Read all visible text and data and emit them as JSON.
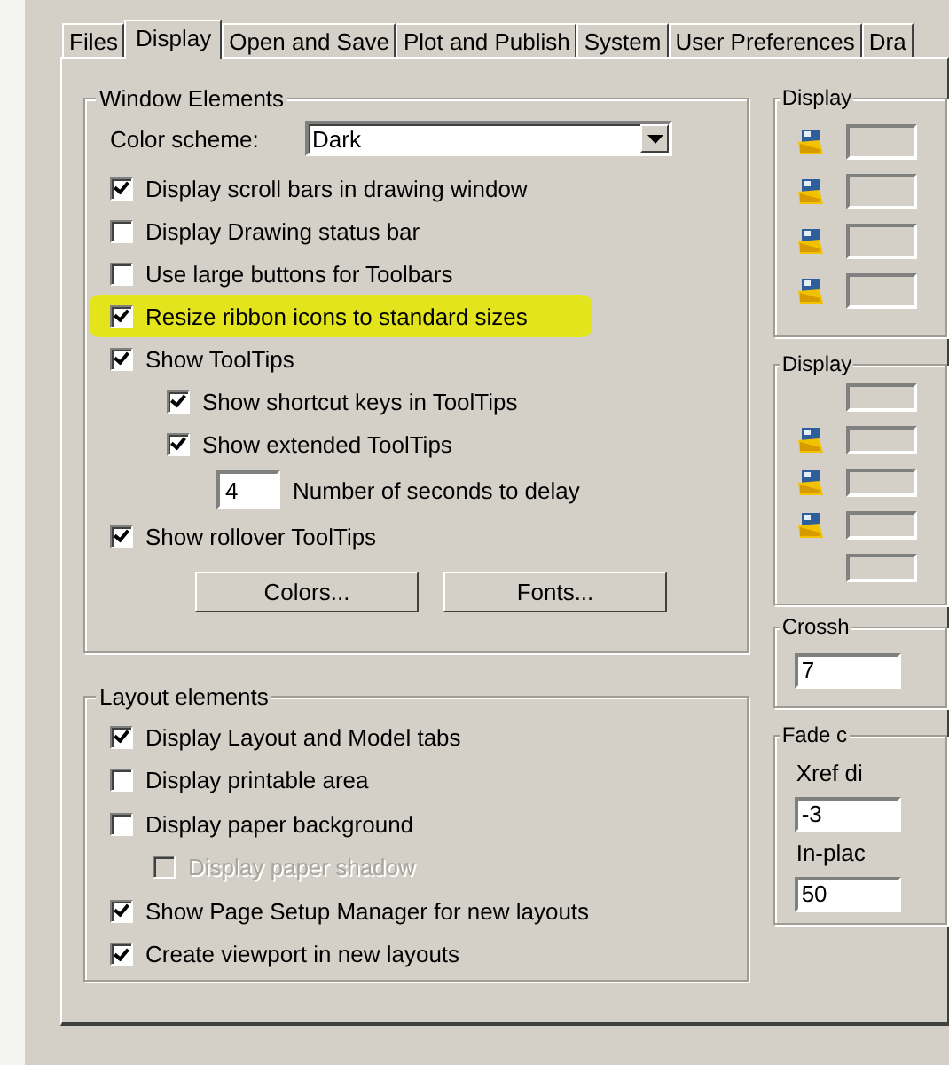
{
  "tabs": [
    {
      "label": "Files",
      "selected": false
    },
    {
      "label": "Display",
      "selected": true
    },
    {
      "label": "Open and Save",
      "selected": false
    },
    {
      "label": "Plot and Publish",
      "selected": false
    },
    {
      "label": "System",
      "selected": false
    },
    {
      "label": "User Preferences",
      "selected": false
    },
    {
      "label": "Dra",
      "selected": false
    }
  ],
  "window_elements": {
    "title": "Window Elements",
    "color_scheme": {
      "label": "Color scheme:",
      "value": "Dark"
    },
    "options": [
      {
        "kind": "checkbox",
        "label": "Display scroll bars in drawing window",
        "checked": true,
        "highlighted": false
      },
      {
        "kind": "checkbox",
        "label": "Display Drawing status bar",
        "checked": false,
        "highlighted": false
      },
      {
        "kind": "checkbox",
        "label": "Use large buttons for Toolbars",
        "checked": false,
        "highlighted": false
      },
      {
        "kind": "checkbox",
        "label": "Resize ribbon icons to standard sizes",
        "checked": true,
        "highlighted": true
      },
      {
        "kind": "checkbox",
        "label": "Show ToolTips",
        "checked": true,
        "highlighted": false,
        "children": [
          {
            "kind": "checkbox",
            "label": "Show shortcut keys in ToolTips",
            "checked": true
          },
          {
            "kind": "checkbox",
            "label": "Show extended ToolTips",
            "checked": true,
            "children": [
              {
                "kind": "number_field",
                "label": "Number of seconds to delay",
                "value": "4"
              }
            ]
          }
        ]
      },
      {
        "kind": "checkbox",
        "label": "Show rollover ToolTips",
        "checked": true,
        "highlighted": false
      }
    ],
    "buttons": [
      "Colors...",
      "Fonts..."
    ]
  },
  "layout_elements": {
    "title": "Layout elements",
    "options": [
      {
        "label": "Display Layout and Model tabs",
        "checked": true,
        "disabled": false
      },
      {
        "label": "Display printable area",
        "checked": false,
        "disabled": false
      },
      {
        "label": "Display paper background",
        "checked": false,
        "disabled": false,
        "children": [
          {
            "label": "Display paper shadow",
            "checked": false,
            "disabled": true
          }
        ]
      },
      {
        "label": "Show Page Setup Manager for new layouts",
        "checked": true,
        "disabled": false
      },
      {
        "label": "Create viewport in new layouts",
        "checked": true,
        "disabled": false
      }
    ]
  },
  "right_group_1": {
    "title": "Display",
    "rows": [
      {
        "kind": "icon_field"
      },
      {
        "kind": "icon_field"
      },
      {
        "kind": "icon_field"
      },
      {
        "kind": "icon_field"
      }
    ]
  },
  "right_group_2": {
    "title": "Display",
    "rows": [
      {
        "kind": "field"
      },
      {
        "kind": "icon_field"
      },
      {
        "kind": "icon_field"
      },
      {
        "kind": "icon_field"
      },
      {
        "kind": "field"
      }
    ]
  },
  "right_group_3": {
    "title": "Crossh",
    "value": "7"
  },
  "right_group_4": {
    "title": "Fade c",
    "fields": [
      {
        "label": "Xref di",
        "value": "-3"
      },
      {
        "label": "In-plac",
        "value": "50"
      }
    ]
  }
}
